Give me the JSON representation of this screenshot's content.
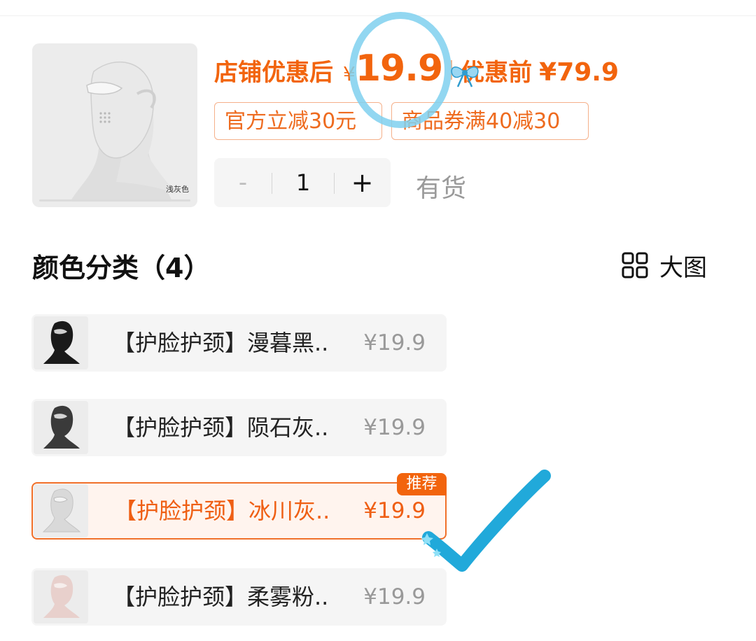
{
  "product": {
    "thumbnail_caption": "浅灰色"
  },
  "price": {
    "label": "店铺优惠后",
    "currency": "¥",
    "value": "19.9",
    "original_label": "优惠前",
    "original_price": "¥79.9"
  },
  "tags": [
    "官方立减30元",
    "商品券满40减30"
  ],
  "quantity": {
    "minus_label": "-",
    "value": "1",
    "plus_label": "+",
    "stock_status": "有货"
  },
  "section": {
    "title": "颜色分类（4）",
    "view_toggle_label": "大图",
    "view_toggle_icon": "grid-icon"
  },
  "options": [
    {
      "name": "【护脸护颈】漫暮黑..",
      "price": "¥19.9",
      "selected": false,
      "thumb_color": "#1a1a1a"
    },
    {
      "name": "【护脸护颈】陨石灰..",
      "price": "¥19.9",
      "selected": false,
      "thumb_color": "#3a3a3a"
    },
    {
      "name": "【护脸护颈】冰川灰..",
      "price": "¥19.9",
      "selected": true,
      "badge": "推荐",
      "thumb_color": "#d9d9d9"
    },
    {
      "name": "【护脸护颈】柔雾粉..",
      "price": "¥19.9",
      "selected": false,
      "thumb_color": "#e8d0cc"
    }
  ],
  "colors": {
    "accent": "#f2640d",
    "annotation": "#2fb6e0"
  }
}
